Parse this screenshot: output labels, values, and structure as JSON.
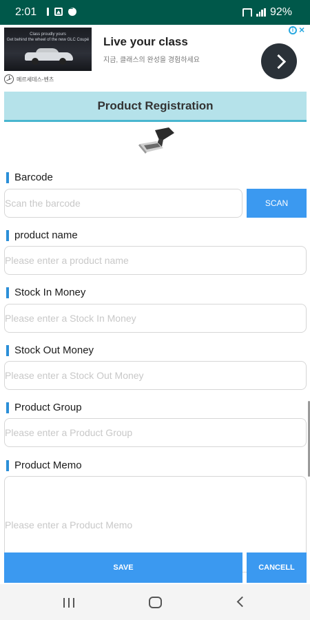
{
  "status_bar": {
    "time": "2:01",
    "battery": "92%"
  },
  "ad": {
    "image_caption": "Class proudly yours\nGet behind the wheel of the new GLC Coupé",
    "brand": "메르세데스-벤츠",
    "title": "Live your class",
    "subtitle": "지금, 클래스의 완성을 경험하세요"
  },
  "header": {
    "title": "Product Registration"
  },
  "form": {
    "barcode": {
      "label": "Barcode",
      "placeholder": "Scan the barcode",
      "scan_label": "SCAN"
    },
    "product_name": {
      "label": "product name",
      "placeholder": "Please enter a product name"
    },
    "stock_in": {
      "label": "Stock In Money",
      "placeholder": "Please enter a Stock In Money"
    },
    "stock_out": {
      "label": "Stock Out Money",
      "placeholder": "Please enter a Stock Out Money"
    },
    "product_group": {
      "label": "Product Group",
      "placeholder": "Please enter a Product Group"
    },
    "product_memo": {
      "label": "Product Memo",
      "placeholder": "Please enter a Product Memo"
    }
  },
  "actions": {
    "save_label": "SAVE",
    "cancel_label": "CANCELL"
  },
  "colors": {
    "status_bar": "#00584a",
    "header_bg": "#b5e2ea",
    "accent_blue": "#3b99f0",
    "label_marker": "#2b8fd8"
  }
}
